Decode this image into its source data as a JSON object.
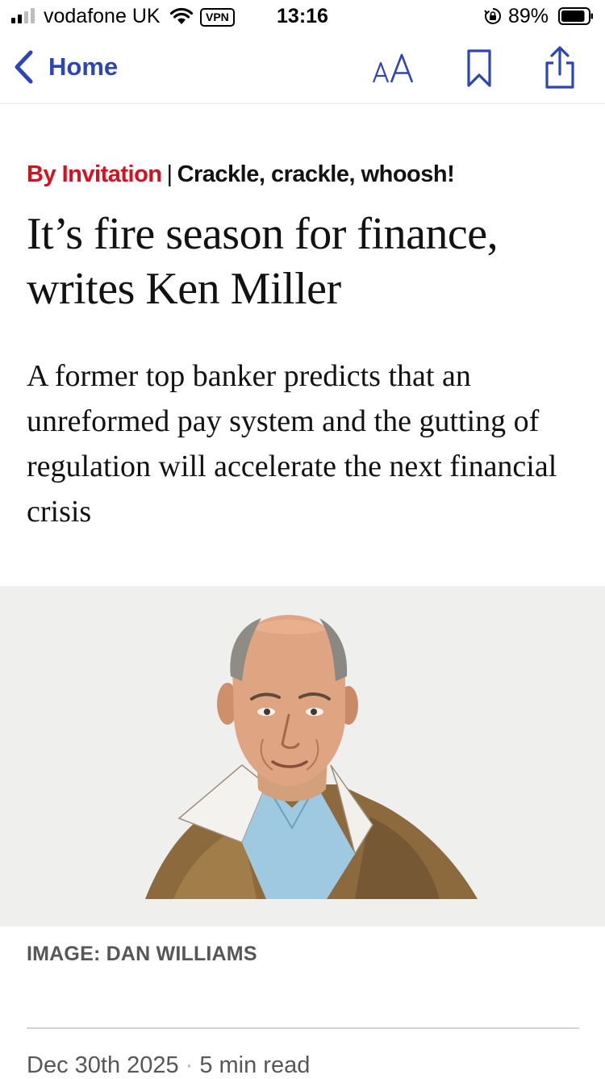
{
  "status_bar": {
    "carrier": "vodafone UK",
    "vpn": "VPN",
    "time": "13:16",
    "battery_percent": "89%",
    "battery_level": 0.89
  },
  "nav": {
    "back_label": "Home",
    "text_size_icon": "text-size-icon",
    "bookmark_icon": "bookmark-icon",
    "share_icon": "share-icon",
    "accent_color": "#2e45b8"
  },
  "article": {
    "section": "By Invitation",
    "separator": "|",
    "fly_title": "Crackle, crackle, whoosh!",
    "headline": "It’s fire season for finance, writes Ken Miller",
    "standfirst": "A former top banker predicts that an unreformed pay system and the gutting of regulation will accelerate the next financial crisis",
    "image_credit": "IMAGE: DAN WILLIAMS",
    "date": "Dec 30th 2025",
    "meta_separator": "·",
    "read_time": "5 min read",
    "section_color": "#d7101e"
  }
}
